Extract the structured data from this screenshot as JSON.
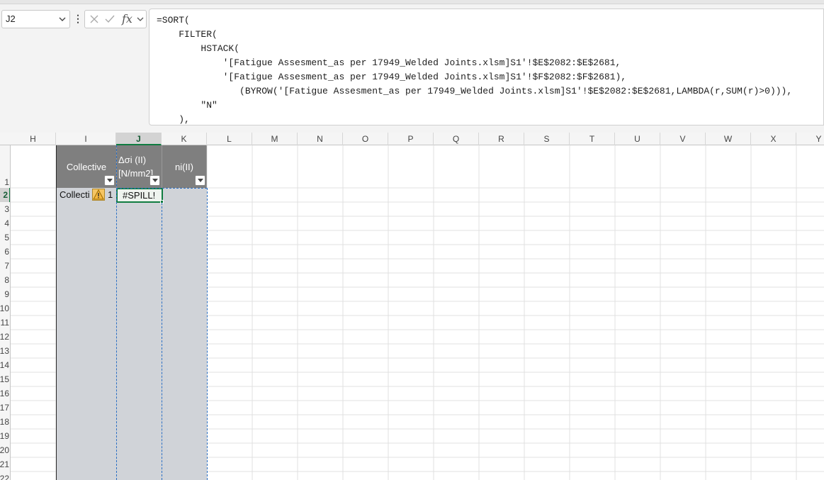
{
  "name_box": {
    "value": "J2"
  },
  "formula_bar": {
    "more_label": "⋮",
    "fx_label": "fx",
    "lines": [
      "=SORT(",
      "    FILTER(",
      "        HSTACK(",
      "            '[Fatigue Assesment_as per 17949_Welded Joints.xlsm]S1'!$E$2082:$E$2681,",
      "            '[Fatigue Assesment_as per 17949_Welded Joints.xlsm]S1'!$F$2082:$F$2681),",
      "               (BYROW('[Fatigue Assesment_as per 17949_Welded Joints.xlsm]S1'!$E$2082:$E$2681,LAMBDA(r,SUM(r)>0))),",
      "        \"N\"",
      "    ),"
    ]
  },
  "columns": [
    "H",
    "I",
    "J",
    "K",
    "L",
    "M",
    "N",
    "O",
    "P",
    "Q",
    "R",
    "S",
    "T",
    "U",
    "V",
    "W",
    "X",
    "Y"
  ],
  "active_column": "J",
  "rows": [
    "1",
    "2",
    "3",
    "4",
    "5",
    "6",
    "7",
    "8",
    "9",
    "10",
    "11",
    "12",
    "13",
    "14",
    "15",
    "16",
    "17",
    "18",
    "19",
    "20",
    "21",
    "22"
  ],
  "active_row": "2",
  "table": {
    "headers": {
      "I": "Collective",
      "J_line1": "Δσi (II)",
      "J_line2": "[N/mm2]",
      "K": "ni(II)"
    },
    "row2": {
      "I": "Collecti",
      "I_suffix": "1",
      "J": "#SPILL!"
    }
  },
  "colors": {
    "table_header": "#7f7f7f",
    "table_body": "#d0d3d8",
    "active": "#107c41",
    "spill_border": "#2b6fc4",
    "warning": "#f5c563"
  }
}
